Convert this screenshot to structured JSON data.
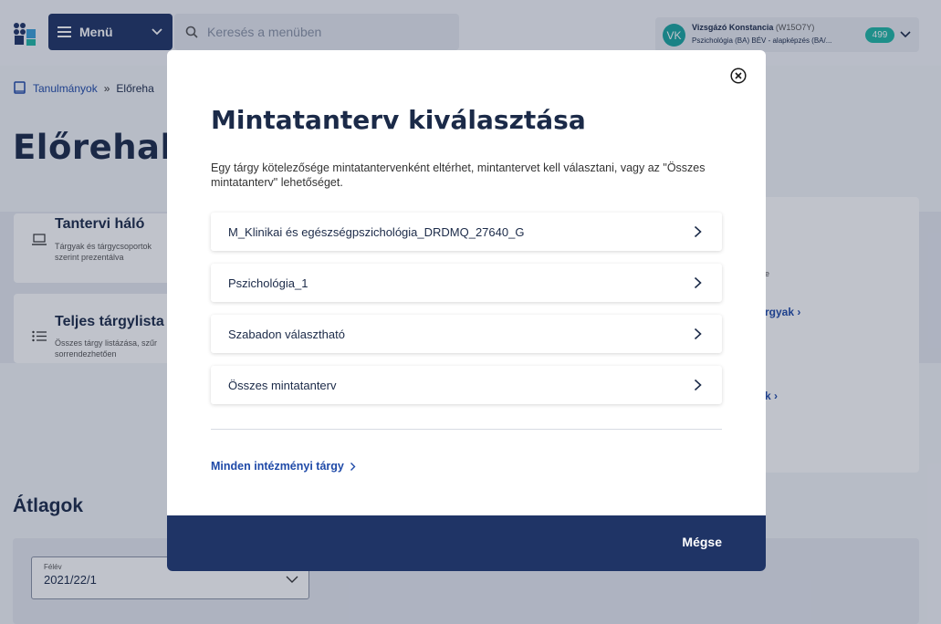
{
  "header": {
    "menu_label": "Menü",
    "search_placeholder": "Keresés a menüben",
    "user": {
      "initials": "VK",
      "name": "Vizsgázó Konstancia",
      "code": "(W15O7Y)",
      "program": "Pszichológia (BA) BÉV - alapképzés (BA/...",
      "badge": "499"
    }
  },
  "breadcrumb": {
    "link": "Tanulmányok",
    "separator": "»",
    "current": "Előreha"
  },
  "page_title": "Előrehala",
  "cards": {
    "curriculum_net": {
      "title": "Tantervi háló",
      "sub_line1": "Tárgyak és tárgycsoportok",
      "sub_line2": "szerint prezentálva"
    },
    "full_list": {
      "title": "Teljes tárgylista",
      "sub_line1": "Összes tárgy listázása, szűr",
      "sub_line2": "sorrendezhetően"
    },
    "right_text_fragment": "e",
    "right_link1": "rgyak",
    "right_link2": "k"
  },
  "averages": {
    "title": "Átlagok",
    "semester_label": "Félév",
    "semester_value": "2021/22/1"
  },
  "modal": {
    "title": "Mintatanterv kiválasztása",
    "description": "Egy tárgy kötelezősége mintatantervenként eltérhet, mintantervet kell választani, vagy az \"Összes mintatanterv\" lehetőséget.",
    "options": [
      {
        "label": "M_Klinikai és egészségpszichológia_DRDMQ_27640_G"
      },
      {
        "label": "Pszichológia_1"
      },
      {
        "label": "Szabadon választható"
      },
      {
        "label": "Összes mintatanterv"
      }
    ],
    "all_institution_link": "Minden intézményi tárgy",
    "cancel_label": "Mégse"
  },
  "colors": {
    "navy": "#1f3466",
    "link_blue": "#1f4aa8",
    "teal": "#1fb8a6"
  }
}
